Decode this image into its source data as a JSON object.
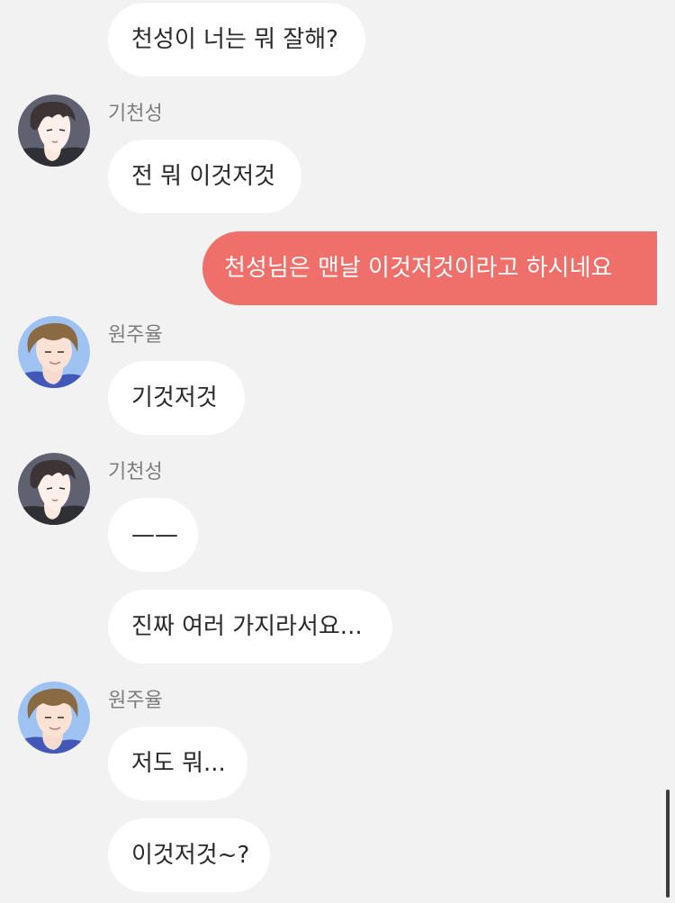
{
  "messages": [
    {
      "text": "천성이 너는 뭐 잘해?"
    },
    {
      "sender": "기천성",
      "avatar_icon": "ki-cheonseong-avatar-icon",
      "text": "전 뭐 이것저것"
    },
    {
      "text": "천성님은 맨날 이것저것이라고 하시네요"
    },
    {
      "sender": "원주율",
      "avatar_icon": "won-juyul-avatar-icon",
      "text": "기것저것"
    },
    {
      "sender": "기천성",
      "avatar_icon": "ki-cheonseong-avatar-icon",
      "text": "——"
    },
    {
      "text": "진짜 여러 가지라서요..."
    },
    {
      "sender": "원주율",
      "avatar_icon": "won-juyul-avatar-icon",
      "text": "저도 뭐..."
    },
    {
      "text": "이것저것~?"
    }
  ],
  "colors": {
    "background": "#f2f2f2",
    "bubble_other": "#ffffff",
    "bubble_mine": "#ef6f6a",
    "text": "#2a2a2a",
    "sender_name": "#7d7d7d"
  }
}
